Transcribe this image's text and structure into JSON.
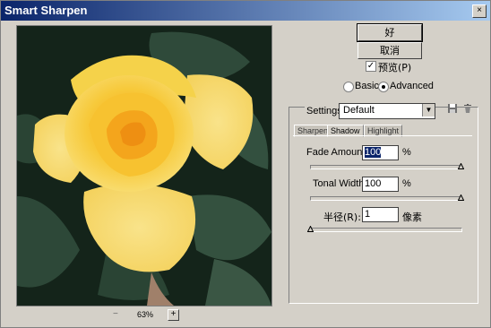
{
  "window": {
    "title": "Smart Sharpen",
    "close_glyph": "×"
  },
  "preview": {
    "zoom": "63%",
    "zoom_out": "−",
    "zoom_in": "+"
  },
  "buttons": {
    "ok": "好",
    "cancel": "取消"
  },
  "preview_check": {
    "label": "预览(P)",
    "checked": true,
    "check_glyph": "✓"
  },
  "mode": {
    "basic": "Basic",
    "advanced": "Advanced",
    "selected": "advanced"
  },
  "settings": {
    "label": "Settings:",
    "value": "Default",
    "arrow": "▼",
    "save_icon": "💾",
    "delete_icon": "🗑"
  },
  "tabs": [
    {
      "label": "Sharpen",
      "active": false
    },
    {
      "label": "Shadow",
      "active": true
    },
    {
      "label": "Highlight",
      "active": false
    }
  ],
  "shadow": {
    "fade_amount": {
      "label": "Fade Amount:",
      "value": "100",
      "unit": "%",
      "fraction": 1.0
    },
    "tonal_width": {
      "label": "Tonal Width:",
      "value": "100",
      "unit": "%",
      "fraction": 1.0
    },
    "radius": {
      "label": "半径(R):",
      "value": "1",
      "unit": "像素",
      "fraction": 0.0
    }
  }
}
